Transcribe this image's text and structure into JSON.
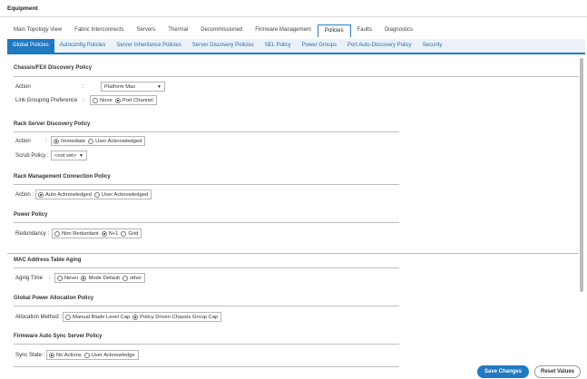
{
  "header": {
    "title": "Equipment"
  },
  "top_tabs": [
    {
      "label": "Main Topology View"
    },
    {
      "label": "Fabric Interconnects"
    },
    {
      "label": "Servers"
    },
    {
      "label": "Thermal"
    },
    {
      "label": "Decommissioned"
    },
    {
      "label": "Firmware Management"
    },
    {
      "label": "Policies",
      "active": true
    },
    {
      "label": "Faults"
    },
    {
      "label": "Diagnostics"
    }
  ],
  "sub_tabs": [
    {
      "label": "Global Policies",
      "active": true
    },
    {
      "label": "Autoconfig Policies"
    },
    {
      "label": "Server Inheritance Policies"
    },
    {
      "label": "Server Discovery Policies"
    },
    {
      "label": "SEL Policy"
    },
    {
      "label": "Power Groups"
    },
    {
      "label": "Port Auto-Discovery Policy"
    },
    {
      "label": "Security"
    }
  ],
  "chassis_fex": {
    "title": "Chassis/FEX Discovery Policy",
    "action_label": "Action",
    "action_colon": ":",
    "action_value": "Platform Max",
    "link_label": "Link Grouping Preference",
    "link_colon": ":",
    "link_options": [
      "None",
      "Port Channel"
    ],
    "link_selected": "Port Channel"
  },
  "rack_server": {
    "title": "Rack Server Discovery Policy",
    "action_label": "Action",
    "action_colon": ":",
    "action_options": [
      "Immediate",
      "User Acknowledged"
    ],
    "action_selected": "Immediate",
    "scrub_label": "Scrub Policy :",
    "scrub_value": "<not set>"
  },
  "rack_mgmt": {
    "title": "Rack Management Connection Policy",
    "action_label": "Action :",
    "options": [
      "Auto Acknowledged",
      "User Acknowledged"
    ],
    "selected": "Auto Acknowledged"
  },
  "power": {
    "title": "Power Policy",
    "label": "Redundancy :",
    "options": [
      "Non Redundant",
      "N+1",
      "Grid"
    ],
    "selected": "N+1"
  },
  "mac_aging": {
    "title": "MAC Address Table Aging",
    "label": "Aging Time",
    "colon": ":",
    "options": [
      "Never",
      "Mode Default",
      "other"
    ],
    "selected": "Mode Default"
  },
  "global_power": {
    "title": "Global Power Allocation Policy",
    "label": "Allocation Method :",
    "options": [
      "Manual Blade Level Cap",
      "Policy Driven Chassis Group Cap"
    ],
    "selected": "Policy Driven Chassis Group Cap"
  },
  "fw_sync": {
    "title": "Firmware Auto Sync Server Policy",
    "label": "Sync State :",
    "options": [
      "No Actions",
      "User Acknowledge"
    ],
    "selected": "No Actions"
  },
  "footer": {
    "save_label": "Save Changes",
    "reset_label": "Reset Values"
  },
  "colors": {
    "accent": "#1f7ac2",
    "subtab_bg": "#eaf1f8"
  },
  "icons": {
    "dropdown": "caret-down-icon"
  }
}
